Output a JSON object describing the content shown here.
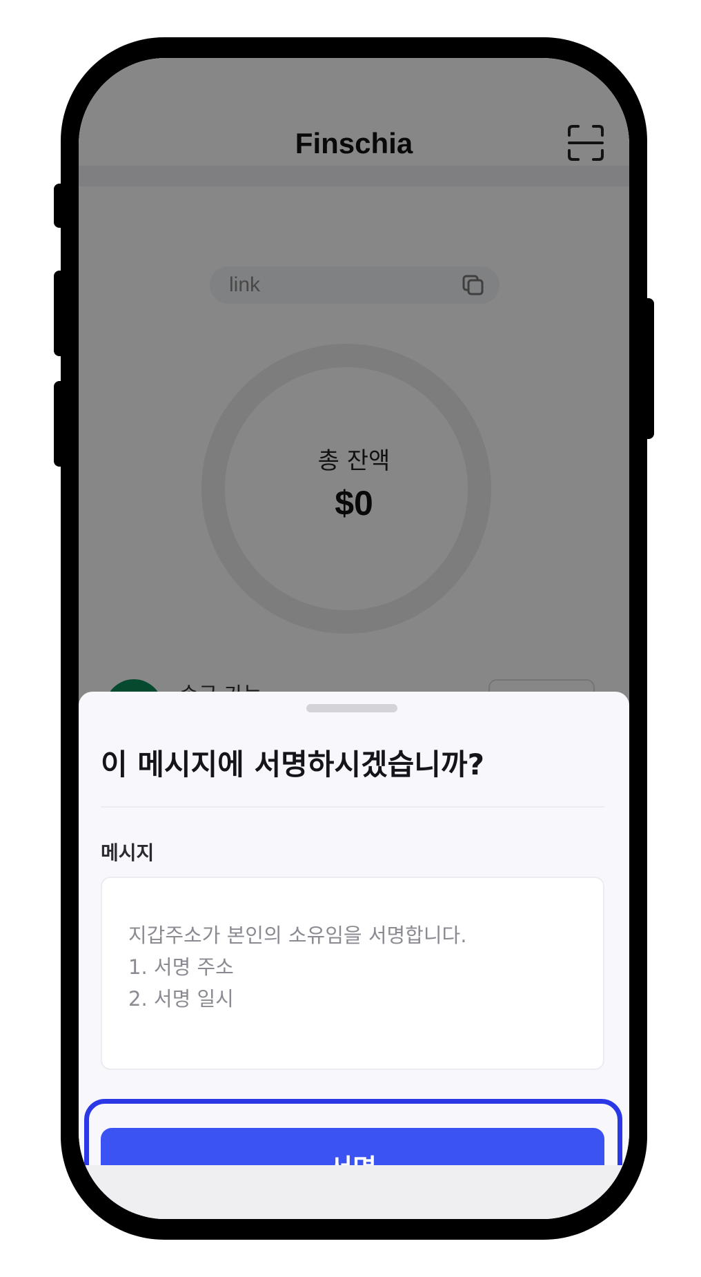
{
  "app": {
    "title": "Finschia",
    "scan_icon": "qr-scan-icon",
    "address_text": "link",
    "copy_icon": "copy-icon",
    "balance_label": "총 잔액",
    "balance_value": "$0",
    "token_label": "송금 가능"
  },
  "sheet": {
    "title": "이 메시지에 서명하시겠습니까?",
    "field_label": "메시지",
    "message_lines": [
      "지갑주소가 본인의 소유임을 서명합니다.",
      "1. 서명 주소",
      "2. 서명 일시"
    ],
    "sign_button_label": "서명"
  },
  "colors": {
    "accent": "#3c53f4",
    "highlight": "#2b38e6",
    "sheet_bg": "#f7f7fc",
    "overlay": "rgba(0,0,0,0.47)"
  }
}
